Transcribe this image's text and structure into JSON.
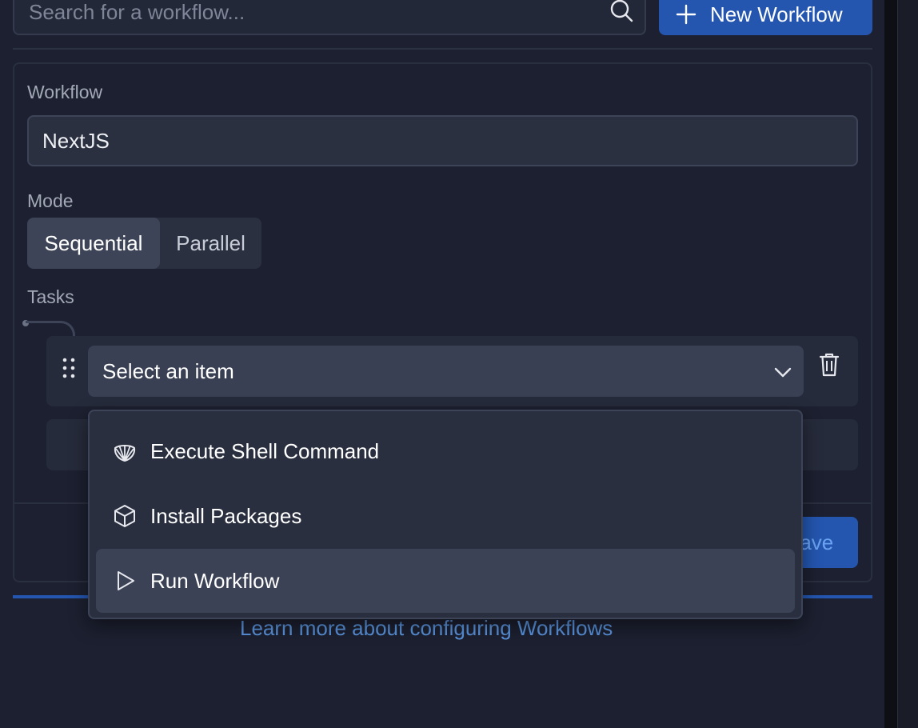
{
  "search": {
    "placeholder": "Search for a workflow..."
  },
  "header": {
    "new_workflow_label": "New Workflow"
  },
  "form": {
    "workflow_label": "Workflow",
    "workflow_value": "NextJS",
    "mode_label": "Mode",
    "modes": [
      {
        "label": "Sequential",
        "active": true
      },
      {
        "label": "Parallel",
        "active": false
      }
    ],
    "tasks_label": "Tasks",
    "task_select_value": "Select an item",
    "save_label": "Save"
  },
  "dropdown": {
    "items": [
      {
        "label": "Execute Shell Command",
        "icon": "shell-icon",
        "highlighted": false
      },
      {
        "label": "Install Packages",
        "icon": "package-icon",
        "highlighted": false
      },
      {
        "label": "Run Workflow",
        "icon": "play-icon",
        "highlighted": true
      }
    ]
  },
  "footer": {
    "learn_more": "Learn more about configuring Workflows"
  },
  "colors": {
    "background": "#1c2030",
    "accent": "#2456b0",
    "link": "#5a93dc",
    "input_bg": "#2b3041",
    "dropdown_bg": "#2a2f40"
  }
}
